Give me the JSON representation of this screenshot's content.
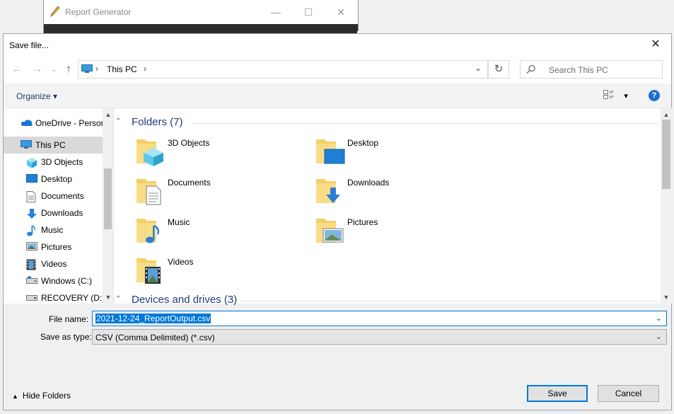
{
  "background_app": {
    "title": "Report Generator",
    "minimize": "—",
    "maximize": "☐",
    "close": "✕"
  },
  "dialog": {
    "title": "Save file...",
    "close": "✕"
  },
  "navigation": {
    "back": "←",
    "forward": "→",
    "recent": "⌄",
    "up": "↑",
    "refresh": "↻",
    "address": {
      "separator": "›",
      "location": "This PC",
      "dropdown": "⌄"
    },
    "search_placeholder": "Search This PC"
  },
  "toolbar": {
    "organize": "Organize ▾",
    "view_dropdown": "▾",
    "help": "?"
  },
  "sidebar": {
    "items": [
      {
        "label": "OneDrive - Persor",
        "icon": "cloud-icon"
      },
      {
        "label": "This PC",
        "icon": "computer-icon",
        "selected": true
      },
      {
        "label": "3D Objects",
        "icon": "cube-icon"
      },
      {
        "label": "Desktop",
        "icon": "desktop-icon"
      },
      {
        "label": "Documents",
        "icon": "document-icon"
      },
      {
        "label": "Downloads",
        "icon": "download-icon"
      },
      {
        "label": "Music",
        "icon": "music-icon"
      },
      {
        "label": "Pictures",
        "icon": "pictures-icon"
      },
      {
        "label": "Videos",
        "icon": "video-icon"
      },
      {
        "label": "Windows (C:)",
        "icon": "drive-icon"
      },
      {
        "label": "RECOVERY (D:)",
        "icon": "drive-icon"
      }
    ]
  },
  "content": {
    "folders_header": "Folders (7)",
    "folders": [
      {
        "label": "3D Objects",
        "overlay": "cube"
      },
      {
        "label": "Desktop",
        "overlay": "desktop"
      },
      {
        "label": "Documents",
        "overlay": "document"
      },
      {
        "label": "Downloads",
        "overlay": "download"
      },
      {
        "label": "Music",
        "overlay": "music"
      },
      {
        "label": "Pictures",
        "overlay": "picture"
      },
      {
        "label": "Videos",
        "overlay": "video"
      }
    ],
    "devices_header": "Devices and drives (3)"
  },
  "form": {
    "file_name_label": "File name:",
    "file_name_value": "2021-12-24_ReportOutput.csv",
    "save_type_label": "Save as type:",
    "save_type_value": "CSV (Comma Delimited) (*.csv)",
    "dropdown_arrow": "⌄"
  },
  "footer": {
    "hide_folders": "Hide Folders",
    "save": "Save",
    "cancel": "Cancel"
  },
  "colors": {
    "accent": "#0078d7",
    "folder": "#f4cf64",
    "header_text": "#1e3c78"
  }
}
